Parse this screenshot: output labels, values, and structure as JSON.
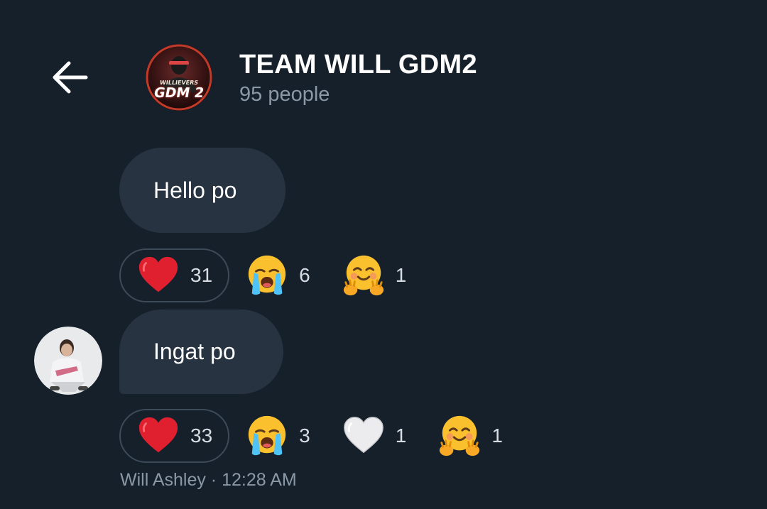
{
  "header": {
    "back_icon": "arrow-left-icon",
    "group_title": "TEAM WILL GDM2",
    "member_count": "95 people",
    "avatar_badge_small": "WILLIEVERS",
    "avatar_badge_big": "GDM 2"
  },
  "messages": [
    {
      "text": "Hello po",
      "reactions": [
        {
          "emoji": "red-heart-icon",
          "count": "31",
          "selected": true
        },
        {
          "emoji": "loudly-crying-face-icon",
          "count": "6",
          "selected": false
        },
        {
          "emoji": "hugging-face-icon",
          "count": "1",
          "selected": false
        }
      ]
    },
    {
      "text": "Ingat po",
      "reactions": [
        {
          "emoji": "red-heart-icon",
          "count": "33",
          "selected": true
        },
        {
          "emoji": "loudly-crying-face-icon",
          "count": "3",
          "selected": false
        },
        {
          "emoji": "white-heart-icon",
          "count": "1",
          "selected": false
        },
        {
          "emoji": "hugging-face-icon",
          "count": "1",
          "selected": false
        }
      ],
      "sender": "Will Ashley",
      "time": "12:28 AM",
      "meta": "Will Ashley · 12:28 AM"
    }
  ],
  "colors": {
    "background": "#15202b",
    "bubble": "#273340",
    "secondary_text": "#8b98a5",
    "reaction_border": "#3d4a57"
  }
}
